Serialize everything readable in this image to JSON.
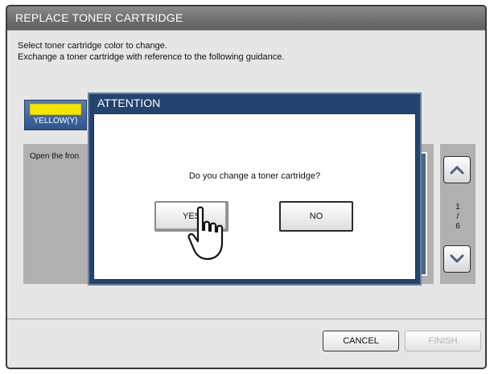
{
  "window": {
    "title": "REPLACE TONER CARTRIDGE"
  },
  "instructions": {
    "line1": "Select toner cartridge color to change.",
    "line2": "Exchange a toner cartridge with reference to the following guidance."
  },
  "color_tab": {
    "label": "YELLOW(Y)",
    "swatch_color": "#f3e600"
  },
  "guidance": {
    "text": "Open the fron"
  },
  "pager": {
    "current": "1",
    "separator": "/",
    "total": "6"
  },
  "footer": {
    "cancel_label": "CANCEL",
    "finish_label": "FINISH"
  },
  "dialog": {
    "title": "ATTENTION",
    "message": "Do you change a toner cartridge?",
    "yes_label": "YES",
    "no_label": "NO"
  },
  "colors": {
    "title_bar": "#707070",
    "dialog_header": "#23446f",
    "accent_tab": "#2f5590",
    "panel_bg": "#e6e6e6"
  }
}
